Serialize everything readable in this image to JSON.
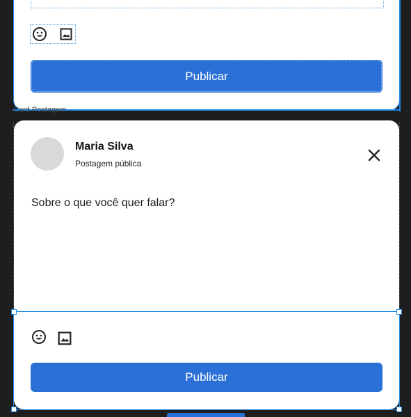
{
  "top_card": {
    "publish_label": "Publicar"
  },
  "frame_label": "Card Postagem",
  "post": {
    "author_name": "Maria Silva",
    "visibility": "Postagem pública",
    "prompt": "Sobre o que você quer falar?",
    "publish_label": "Publicar"
  },
  "icons": {
    "emoji": "emoji-icon",
    "image": "image-icon",
    "close": "close-icon"
  },
  "colors": {
    "accent": "#2b70d6",
    "selection": "#1e88e5"
  }
}
